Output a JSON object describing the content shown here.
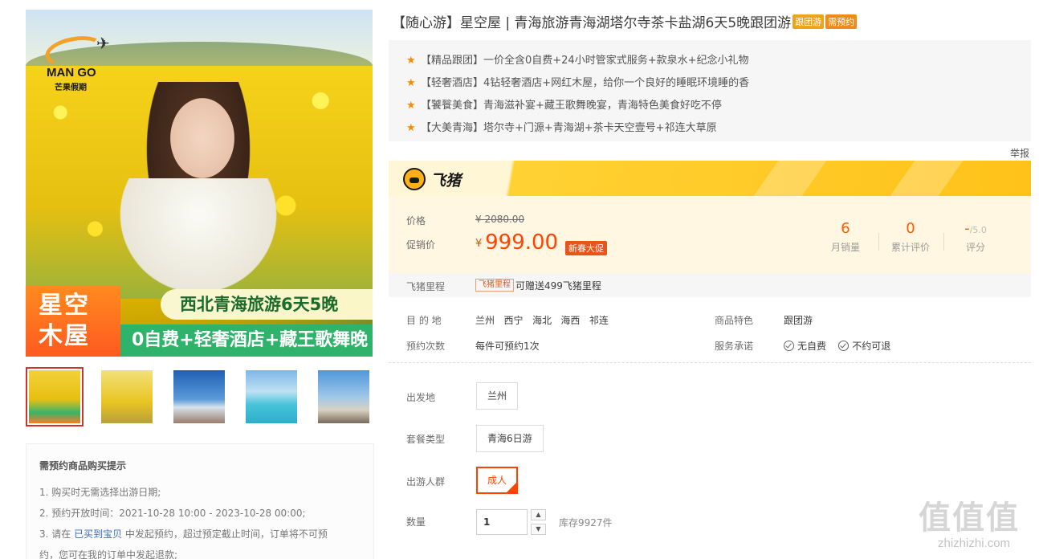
{
  "product": {
    "title": "【随心游】星空屋 | 青海旅游青海湖塔尔寺茶卡盐湖6天5晚跟团游",
    "tags": [
      "跟团游",
      "需预约"
    ]
  },
  "main_image": {
    "logo_brand": "MAN GO",
    "logo_cn": "芒果假期",
    "banner_left": [
      "星空",
      "木屋"
    ],
    "banner_top": "西北青海旅游6天5晚",
    "banner_bottom": "0自费+轻奢酒店+藏王歌舞晚宴"
  },
  "highlights": [
    "【精品跟团】一价全含0自费+24小时管家式服务+款泉水+纪念小礼物",
    "【轻奢酒店】4钻轻奢酒店+网红木屋，给你一个良好的睡眠环境睡的香",
    "【饕餮美食】青海滋补宴+藏王歌舞晚宴，青海特色美食好吃不停",
    "【大美青海】塔尔寺+门源+青海湖+茶卡天空壹号+祁连大草原"
  ],
  "report_label": "举报",
  "platform": {
    "name": "飞猪"
  },
  "price": {
    "orig_label": "价格",
    "orig_value": "¥ 2080.00",
    "promo_label": "促销价",
    "currency": "¥",
    "promo_value": "999.00",
    "promo_tag": "新春大促"
  },
  "stats": [
    {
      "value": "6",
      "label": "月销量"
    },
    {
      "value": "0",
      "label": "累计评价"
    },
    {
      "value": "-",
      "suffix": "/5.0",
      "label": "评分"
    }
  ],
  "mileage": {
    "label": "飞猪里程",
    "tag": "飞猪里程",
    "text": "可赠送499飞猪里程"
  },
  "attrs": {
    "dest_label": "目 的 地",
    "dest_values": [
      "兰州",
      "西宁",
      "海北",
      "海西",
      "祁连"
    ],
    "booking_label": "预约次数",
    "booking_value": "每件可预约1次",
    "feature_label": "商品特色",
    "feature_value": "跟团游",
    "service_label": "服务承诺",
    "service_values": [
      "无自费",
      "不约可退"
    ]
  },
  "sku": {
    "departure_label": "出发地",
    "departure_value": "兰州",
    "package_label": "套餐类型",
    "package_value": "青海6日游",
    "crowd_label": "出游人群",
    "crowd_value": "成人",
    "qty_label": "数量",
    "qty_value": "1",
    "stock": "库存9927件"
  },
  "notice": {
    "title": "需预约商品购买提示",
    "line1": "1. 购买时无需选择出游日期;",
    "line2": "2. 预约开放时间：2021-10-28 10:00 - 2023-10-28 00:00;",
    "line3_pre": "3. 请在 ",
    "line3_link": "已买到宝贝",
    "line3_post": " 中发起预约，超过预定截止时间，订单将不可预",
    "line4": "约，您可在我的订单中发起退款;"
  },
  "watermark": {
    "main": "值值值",
    "sub": "zhizhizhi.com"
  },
  "colors": {
    "accent": "#ff4400",
    "promo_tag": "#e8541a",
    "feizhu_yellow": "#ffc21a",
    "tag_orange": "#f0a21a"
  }
}
